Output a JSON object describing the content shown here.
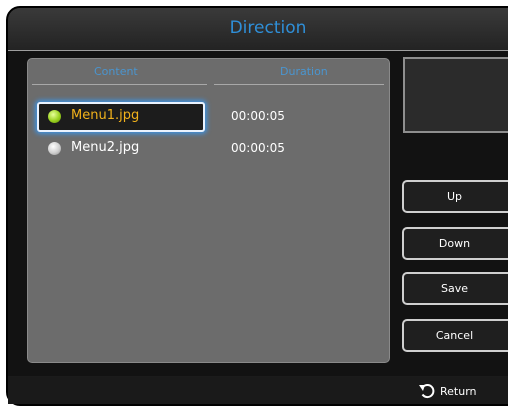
{
  "dialog": {
    "title": "Direction"
  },
  "list": {
    "columns": {
      "content": "Content",
      "duration": "Duration"
    },
    "rows": [
      {
        "name": "Menu1.jpg",
        "duration": "00:00:05",
        "selected": true
      },
      {
        "name": "Menu2.jpg",
        "duration": "00:00:05",
        "selected": false
      }
    ]
  },
  "buttons": {
    "up": "Up",
    "down": "Down",
    "save": "Save",
    "cancel": "Cancel"
  },
  "footer": {
    "return_label": "Return",
    "return_icon": "return-icon"
  },
  "colors": {
    "title_text": "#2f8fd8",
    "column_header": "#4a95cf",
    "selected_text": "#f2b21b",
    "focus_glow": "#3f92e0"
  }
}
